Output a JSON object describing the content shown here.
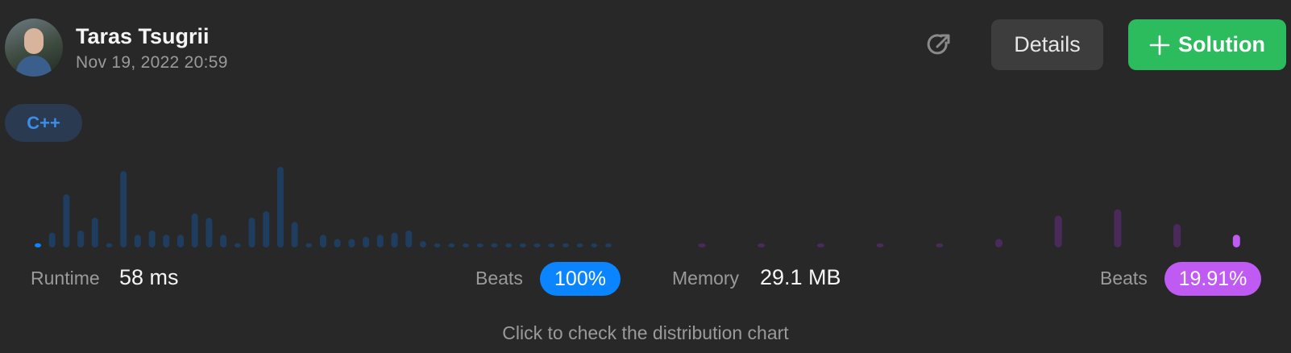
{
  "user": {
    "name": "Taras Tsugrii",
    "date": "Nov 19, 2022 20:59"
  },
  "actions": {
    "share_icon": "share-icon",
    "details_label": "Details",
    "solution_label": "Solution"
  },
  "language": "C++",
  "stats": {
    "runtime_label": "Runtime",
    "runtime_value": "58 ms",
    "runtime_beats_label": "Beats",
    "runtime_beats_value": "100%",
    "memory_label": "Memory",
    "memory_value": "29.1 MB",
    "memory_beats_label": "Beats",
    "memory_beats_value": "19.91%"
  },
  "footer_hint": "Click to check the distribution chart",
  "colors": {
    "runtime_accent": "#0a84ff",
    "memory_accent": "#bf5af2",
    "solution_green": "#2cbb5d"
  },
  "chart_data": [
    {
      "type": "bar",
      "name": "runtime-distribution",
      "highlight_index": 0,
      "values": [
        2,
        7,
        25,
        8,
        14,
        2,
        36,
        6,
        8,
        6,
        6,
        16,
        14,
        6,
        2,
        14,
        17,
        38,
        12,
        2,
        6,
        4,
        4,
        5,
        6,
        7,
        8,
        3,
        1,
        1,
        1,
        1,
        2,
        1,
        1,
        1,
        1,
        2,
        1,
        1,
        1
      ]
    },
    {
      "type": "bar",
      "name": "memory-distribution",
      "highlight_index": 9,
      "values": [
        1,
        1,
        1,
        1,
        1,
        4,
        15,
        18,
        11,
        6
      ]
    }
  ]
}
